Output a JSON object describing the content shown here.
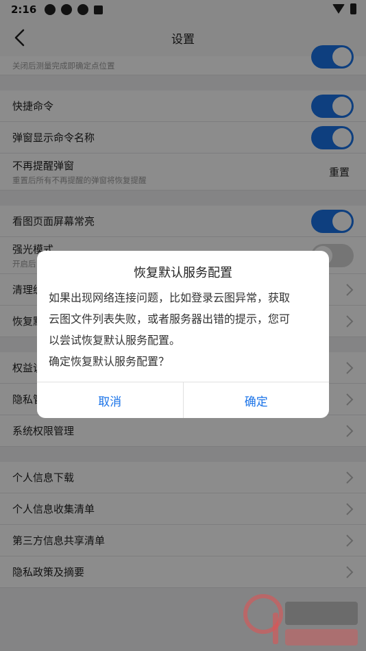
{
  "status_bar": {
    "time": "2:16"
  },
  "header": {
    "title": "设置"
  },
  "partial_row": {
    "sub": "关闭后测量完成即确定点位置"
  },
  "rows": {
    "shortcut_cmd": "快捷命令",
    "popup_cmd_name": "弹窗显示命令名称",
    "no_remind": "不再提醒弹窗",
    "no_remind_sub": "重置后所有不再提醒的弹窗将恢复提醒",
    "reset_label": "重置",
    "screen_on": "看图页面屏幕常亮",
    "strong_light": "强光模式",
    "strong_light_sub": "开启后",
    "clear": "清理缓",
    "restore": "恢复默",
    "rights": "权益说",
    "privacy": "隐私管",
    "sys_perm": "系统权限管理",
    "personal_download": "个人信息下载",
    "personal_collect": "个人信息收集清单",
    "third_party": "第三方信息共享清单",
    "privacy_policy": "隐私政策及摘要"
  },
  "dialog": {
    "title": "恢复默认服务配置",
    "message_line1": "如果出现网络连接问题，比如登录云图异常，获取",
    "message_line2": "云图文件列表失败，或者服务器出错的提示，您可",
    "message_line3": "以尝试恢复默认服务配置。",
    "message_line4": "确定恢复默认服务配置？",
    "cancel": "取消",
    "confirm": "确定"
  },
  "colors": {
    "accent": "#1a73e8",
    "toggle_off": "#d6d6d6"
  }
}
